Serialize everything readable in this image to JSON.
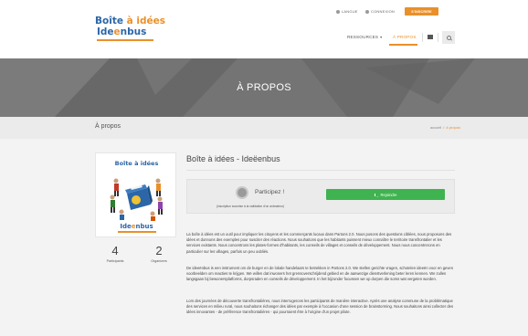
{
  "header": {
    "logo_line1_a": "Boîte ",
    "logo_line1_b": "à idées",
    "logo_line2_a": "Ide",
    "logo_line2_b": "e",
    "logo_line2_c": "nbus",
    "language": "LANGUE",
    "connexion": "CONNEXION",
    "signup": "S'INSCRIRE",
    "nav": {
      "resources": "RESSOURCES",
      "about": "À PROPOS"
    }
  },
  "banner": {
    "title": "À PROPOS"
  },
  "breadcrumb": {
    "page_title": "À propos",
    "home": "accueil",
    "sep": "/",
    "current": "à propos"
  },
  "sidebar": {
    "card_title": "Boîte à idées",
    "card_brand_a": "Ide",
    "card_brand_b": "e",
    "card_brand_c": "nbus",
    "stats": [
      {
        "value": "4",
        "label": "Participants"
      },
      {
        "value": "2",
        "label": "Organizers"
      }
    ]
  },
  "main": {
    "title": "Boîte à idées - Ideëenbus",
    "participate_label": "Participez !",
    "participate_note": "(inscription soumise à la validation d'un animateur)",
    "join_button": "Rejoindre",
    "paragraphs": [
      "La boîte à idées est un outil pour impliquer les citoyens et les commerçants locaux dans Partons 2.0. Nous posons des questions ciblées, nous proposons des idées et donnons des exemples pour susciter des réactions. Nous souhaitons que les habitants puissent mieux connaître le territoire transfrontalier et les services existants. Nous concentrons les plates-formes d'habitants, les conseils de villages et conseils de développement. Nous nous concentrerons en particulier sur les villages, parfois un peu oubliés.",
      "De ideeënbus is een instrument om de burger en de lokale handelaars te betrekken in Partons 2.0. We stellen gerichte vragen, schotelen ideeën voor en geven voorbeelden om reacties te krijgen. We willen dat inwoners het grensoverschrijdend gebied en de aanwezige dienstverlening beter leren kennen. We zullen langsgaan bij bewonersplatforms, dorpsraden en conseils de développement. In het bijzonder focussen we op dorpen die soms wat vergeten worden.",
      "Lors des journées de découverte transfrontalières, nous interrogerons les participants de manière interactive. Après une analyse commune de la problématique des services en milieu rural, nous souhaitons échanger des idées par exemple à l'occasion d'une session de brainstorming. Nous souhaitons ainsi collecter des idées innovantes - de préférence transfrontalières - qui pourraient être à l'origine d'un projet pilote."
    ]
  },
  "colors": {
    "accent": "#e9902a",
    "brand_blue": "#2b66a8",
    "join_green": "#3fb34f"
  }
}
